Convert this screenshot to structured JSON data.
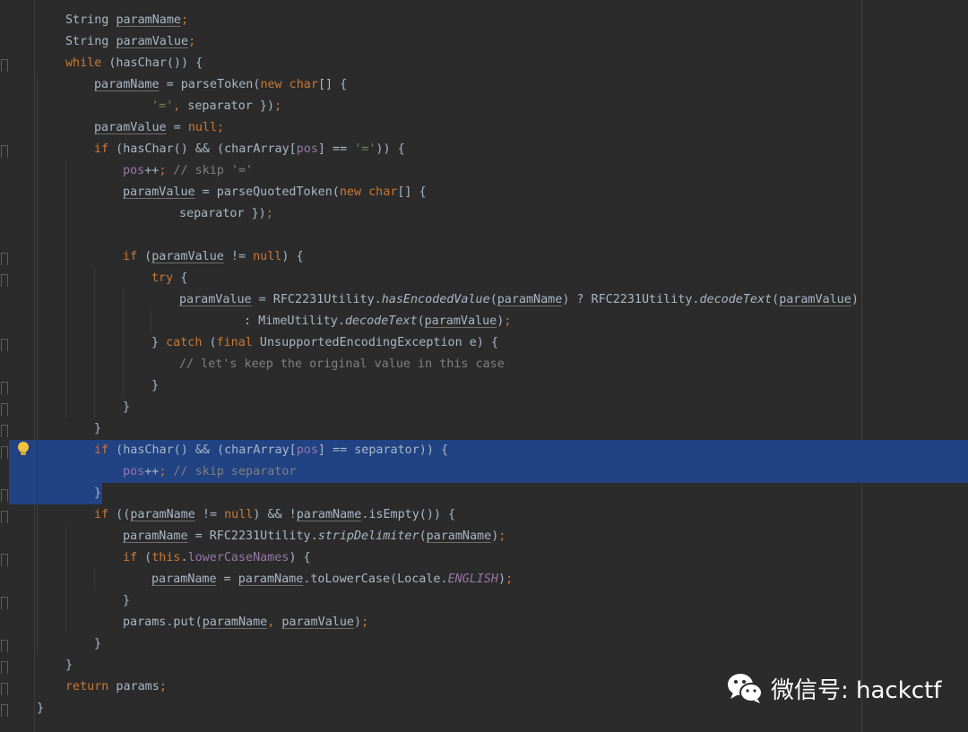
{
  "editor": {
    "theme": {
      "background": "#2b2b2b",
      "keyword": "#cc7832",
      "field": "#9876aa",
      "string": "#6a8759",
      "comment": "#808080",
      "default": "#a9b7c6",
      "selection": "#214283"
    },
    "lines": [
      [
        [
          "",
          "String "
        ],
        [
          "ul",
          "paramName"
        ],
        [
          "kw",
          ";"
        ]
      ],
      [
        [
          "",
          "String "
        ],
        [
          "ul",
          "paramValue"
        ],
        [
          "kw",
          ";"
        ]
      ],
      [
        [
          "kw",
          "while"
        ],
        [
          "",
          " (hasChar()) {"
        ]
      ],
      [
        [
          "ul",
          "paramName"
        ],
        [
          "",
          " = parseToken("
        ],
        [
          "kw",
          "new char"
        ],
        [
          "",
          "[] {"
        ]
      ],
      [
        [
          "str",
          "'='"
        ],
        [
          "kw",
          ","
        ],
        [
          "",
          " separator })"
        ],
        [
          "kw",
          ";"
        ]
      ],
      [
        [
          "ul",
          "paramValue"
        ],
        [
          "",
          " = "
        ],
        [
          "kw",
          "null;"
        ]
      ],
      [
        [
          "kw",
          "if"
        ],
        [
          "",
          " (hasChar() && (charArray["
        ],
        [
          "fld",
          "pos"
        ],
        [
          "",
          "] == "
        ],
        [
          "str",
          "'='"
        ],
        [
          "",
          ")) {"
        ]
      ],
      [
        [
          "fld",
          "pos"
        ],
        [
          "",
          "++"
        ],
        [
          "kw",
          ";"
        ],
        [
          "cmt",
          " // skip '='"
        ]
      ],
      [
        [
          "ul",
          "paramValue"
        ],
        [
          "",
          " = parseQuotedToken("
        ],
        [
          "kw",
          "new char"
        ],
        [
          "",
          "[] {"
        ]
      ],
      [
        [
          "",
          "separator })"
        ],
        [
          "kw",
          ";"
        ]
      ],
      [],
      [
        [
          "kw",
          "if"
        ],
        [
          "",
          " ("
        ],
        [
          "ul",
          "paramValue"
        ],
        [
          "",
          " != "
        ],
        [
          "kw",
          "null"
        ],
        [
          "",
          ") {"
        ]
      ],
      [
        [
          "kw",
          "try"
        ],
        [
          "",
          " {"
        ]
      ],
      [
        [
          "ul",
          "paramValue"
        ],
        [
          "",
          " = RFC2231Utility."
        ],
        [
          "ital",
          "hasEncodedValue"
        ],
        [
          "",
          "("
        ],
        [
          "ul",
          "paramName"
        ],
        [
          "",
          ") ? RFC2231Utility."
        ],
        [
          "ital",
          "decodeText"
        ],
        [
          "",
          "("
        ],
        [
          "ul",
          "paramValue"
        ],
        [
          "",
          ")"
        ]
      ],
      [
        [
          "",
          " : MimeUtility."
        ],
        [
          "ital",
          "decodeText"
        ],
        [
          "",
          "("
        ],
        [
          "ul",
          "paramValue"
        ],
        [
          "",
          ")"
        ],
        [
          "kw",
          ";"
        ]
      ],
      [
        [
          "",
          "} "
        ],
        [
          "kw",
          "catch"
        ],
        [
          "",
          " ("
        ],
        [
          "kw",
          "final"
        ],
        [
          "",
          " UnsupportedEncodingException e) {"
        ]
      ],
      [
        [
          "cmt",
          "// let's keep the original value in this case"
        ]
      ],
      [
        [
          "",
          "}"
        ]
      ],
      [
        [
          "",
          "}"
        ]
      ],
      [
        [
          "",
          "}"
        ]
      ],
      [
        [
          "kw",
          "if"
        ],
        [
          "",
          " (hasChar() && (charArray["
        ],
        [
          "fld",
          "pos"
        ],
        [
          "",
          "] == separator)) {"
        ]
      ],
      [
        [
          "fld",
          "pos"
        ],
        [
          "",
          "++"
        ],
        [
          "kw",
          ";"
        ],
        [
          "cmt",
          " // skip separator"
        ]
      ],
      [
        [
          "",
          "}"
        ]
      ],
      [
        [
          "kw",
          "if"
        ],
        [
          "",
          " (("
        ],
        [
          "ul",
          "paramName"
        ],
        [
          "",
          " != "
        ],
        [
          "kw",
          "null"
        ],
        [
          "",
          ") && !"
        ],
        [
          "ul",
          "paramName"
        ],
        [
          "",
          ".isEmpty()) {"
        ]
      ],
      [
        [
          "ul",
          "paramName"
        ],
        [
          "",
          " = RFC2231Utility."
        ],
        [
          "ital",
          "stripDelimiter"
        ],
        [
          "",
          "("
        ],
        [
          "ul",
          "paramName"
        ],
        [
          "",
          ")"
        ],
        [
          "kw",
          ";"
        ]
      ],
      [
        [
          "kw",
          "if"
        ],
        [
          "",
          " ("
        ],
        [
          "kw",
          "this"
        ],
        [
          "",
          "."
        ],
        [
          "fld",
          "lowerCaseNames"
        ],
        [
          "",
          ") {"
        ]
      ],
      [
        [
          "ul",
          "paramName"
        ],
        [
          "",
          " = "
        ],
        [
          "ul",
          "paramName"
        ],
        [
          "",
          ".toLowerCase(Locale."
        ],
        [
          "const",
          "ENGLISH"
        ],
        [
          "",
          ")"
        ],
        [
          "kw",
          ";"
        ]
      ],
      [
        [
          "",
          "}"
        ]
      ],
      [
        [
          "",
          "params.put("
        ],
        [
          "ul",
          "paramName"
        ],
        [
          "kw",
          ", "
        ],
        [
          "ul",
          "paramValue"
        ],
        [
          "",
          ")"
        ],
        [
          "kw",
          ";"
        ]
      ],
      [
        [
          "",
          "}"
        ]
      ],
      [
        [
          "",
          "}"
        ]
      ],
      [
        [
          "kw",
          "return"
        ],
        [
          "",
          " params"
        ],
        [
          "kw",
          ";"
        ]
      ],
      [
        [
          "",
          "}"
        ]
      ]
    ]
  },
  "watermark": {
    "label": "微信号: hackctf",
    "icon": "wechat-icon"
  }
}
